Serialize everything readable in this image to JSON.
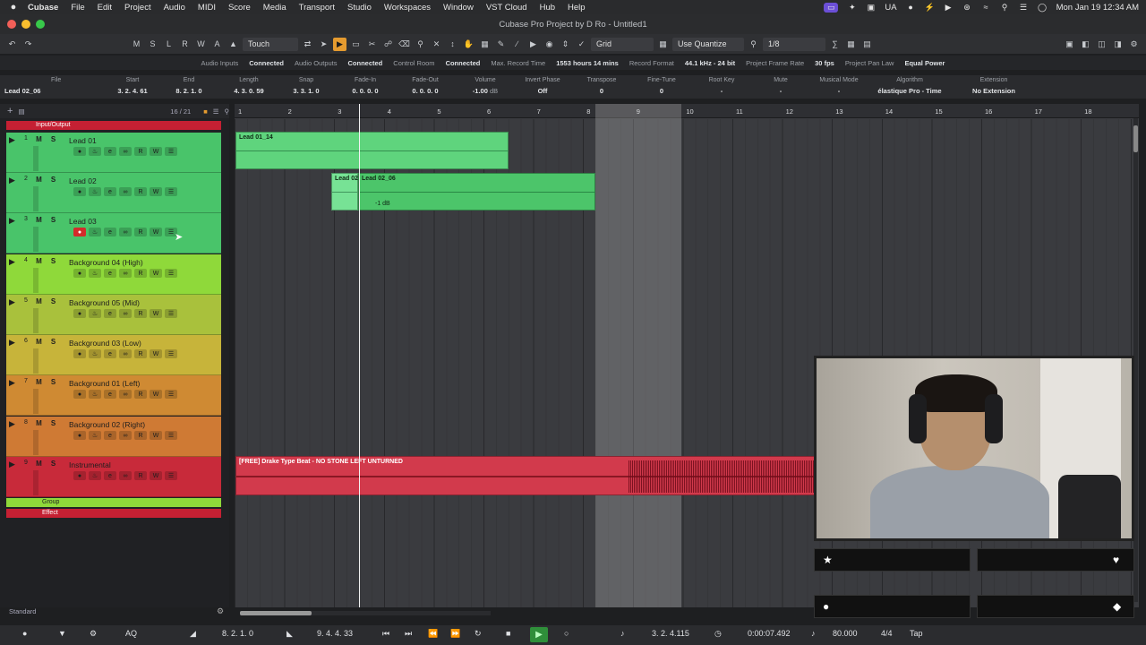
{
  "menubar": {
    "apple": "",
    "items": [
      "Cubase",
      "File",
      "Edit",
      "Project",
      "Audio",
      "MIDI",
      "Score",
      "Media",
      "Transport",
      "Studio",
      "Workspaces",
      "Window",
      "VST Cloud",
      "Hub",
      "Help"
    ],
    "status_label": "UA",
    "clock": "Mon Jan 19  12:34 AM"
  },
  "window": {
    "title": "Cubase Pro Project by D Ro - Untitled1"
  },
  "toolbar": {
    "mode_buttons": [
      "M",
      "S",
      "L",
      "R",
      "W",
      "A"
    ],
    "automation_mode": "Touch",
    "snap_type": "Grid",
    "quantize_mode": "Use Quantize",
    "quantize_value": "1/8"
  },
  "status_line": {
    "audio_inputs_label": "Audio Inputs",
    "audio_inputs_value": "Connected",
    "audio_outputs_label": "Audio Outputs",
    "audio_outputs_value": "Connected",
    "control_room_label": "Control Room",
    "control_room_value": "Connected",
    "max_record_label": "Max. Record Time",
    "max_record_value": "1553 hours 14 mins",
    "record_format_label": "Record Format",
    "record_format_value": "44.1 kHz - 24 bit",
    "frame_rate_label": "Project Frame Rate",
    "frame_rate_value": "30 fps",
    "pan_law_label": "Project Pan Law",
    "pan_law_value": "Equal Power"
  },
  "info_line": {
    "file_label": "File",
    "file_value": "Lead 02_06",
    "start_label": "Start",
    "start_value": "3. 2. 4. 61",
    "end_label": "End",
    "end_value": "8. 2. 1.    0",
    "length_label": "Length",
    "length_value": "4. 3. 0. 59",
    "snap_label": "Snap",
    "snap_value": "3. 3. 1.    0",
    "fadein_label": "Fade-In",
    "fadein_value": "0. 0. 0.    0",
    "fadeout_label": "Fade-Out",
    "fadeout_value": "0. 0. 0.    0",
    "volume_label": "Volume",
    "volume_value": "-1.00",
    "volume_unit": "dB",
    "invert_label": "Invert Phase",
    "invert_value": "Off",
    "transpose_label": "Transpose",
    "transpose_value": "0",
    "finetune_label": "Fine-Tune",
    "finetune_value": "0",
    "rootkey_label": "Root Key",
    "rootkey_value": "-",
    "mute_label": "Mute",
    "mute_value": "-",
    "musicalmode_label": "Musical Mode",
    "musicalmode_value": "-",
    "algorithm_label": "Algorithm",
    "algorithm_value": "élastique Pro - Time",
    "extension_label": "Extension",
    "extension_value": "No Extension"
  },
  "track_panel": {
    "count": "16 / 21",
    "io_label": "Input/Output",
    "group_label": "Group",
    "effect_label": "Effect",
    "footer": "Standard",
    "tracks": [
      {
        "num": "1",
        "name": "Lead 01",
        "color": "#49c46a"
      },
      {
        "num": "2",
        "name": "Lead 02",
        "color": "#49c46a"
      },
      {
        "num": "3",
        "name": "Lead 03",
        "color": "#49c46a"
      },
      {
        "num": "4",
        "name": "Background 04 (High)",
        "color": "#8fd93a"
      },
      {
        "num": "5",
        "name": "Background 05 (Mid)",
        "color": "#a9c13c"
      },
      {
        "num": "6",
        "name": "Background 03 (Low)",
        "color": "#c7b43a"
      },
      {
        "num": "7",
        "name": "Background 01 (Left)",
        "color": "#cf8a33"
      },
      {
        "num": "8",
        "name": "Background 02 (Right)",
        "color": "#cf7a34"
      },
      {
        "num": "9",
        "name": "Instrumental",
        "color": "#c82a3a"
      }
    ]
  },
  "ruler": {
    "bars": [
      "1",
      "2",
      "3",
      "4",
      "5",
      "6",
      "7",
      "8",
      "9",
      "10",
      "11",
      "12",
      "13",
      "14",
      "15",
      "16",
      "17",
      "18"
    ]
  },
  "parts": {
    "lead01": "Lead 01_14",
    "lead02a": "Lead 02",
    "lead02b": "Lead 02_06",
    "lead02_gain": "-1 dB",
    "instrumental": "[FREE] Drake Type Beat - NO STONE LEFT UNTURNED"
  },
  "transport": {
    "left_locator": "8. 2. 1.    0",
    "right_locator": "9. 4. 4. 33",
    "position": "3. 2. 4.115",
    "time": "0:00:07.492",
    "tempo": "80.000",
    "signature": "4/4",
    "tap_label": "Tap"
  },
  "colors": {
    "accent": "#e59b2f",
    "record": "#d32b2b",
    "play": "#2f8f3a"
  }
}
